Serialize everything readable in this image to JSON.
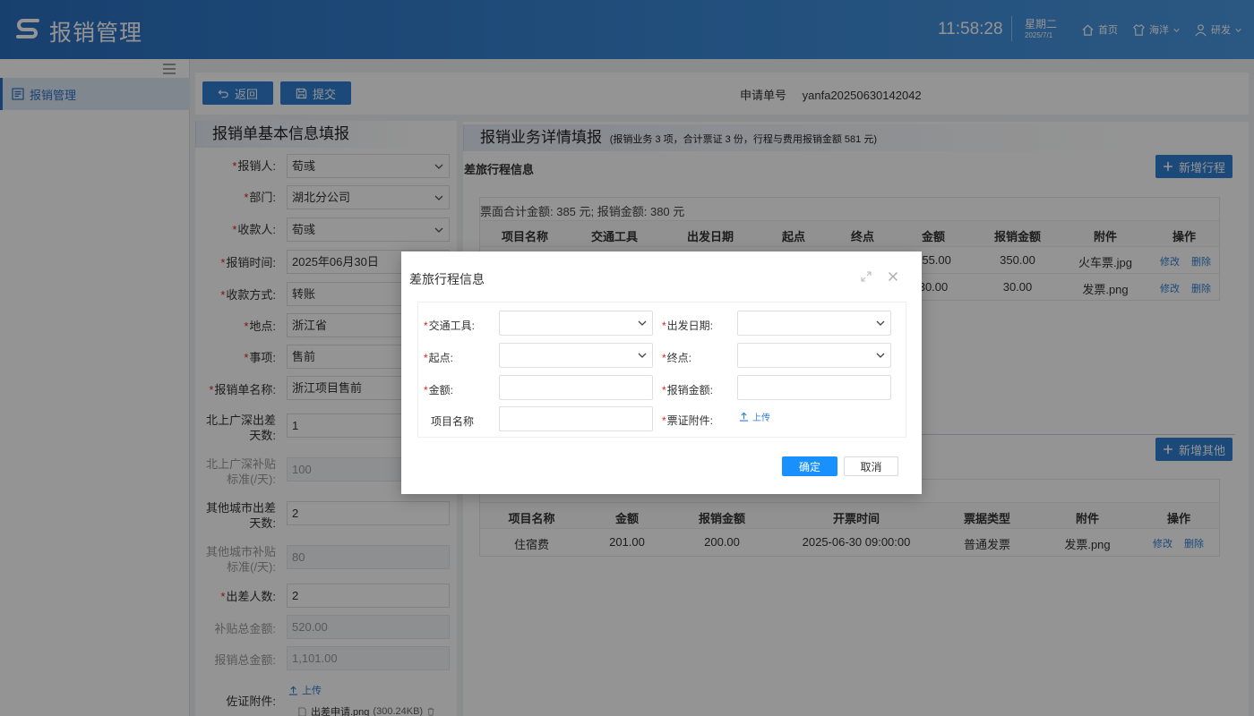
{
  "header": {
    "app_title": "报销管理",
    "clock": "11:58:28",
    "weekday": "星期二",
    "date": "2025/7/1",
    "nav_home": "首页",
    "nav_theme": "海洋",
    "nav_user": "研发"
  },
  "sidebar": {
    "items": [
      {
        "label": "报销管理"
      }
    ]
  },
  "toolbar": {
    "back_label": "返回",
    "submit_label": "提交",
    "app_no_label": "申请单号",
    "app_no_value": "yanfa20250630142042"
  },
  "basic": {
    "title": "报销单基本信息填报",
    "fields": [
      {
        "label": "报销人:",
        "value": "荀彧"
      },
      {
        "label": "部门:",
        "value": "湖北分公司"
      },
      {
        "label": "收款人:",
        "value": "荀彧"
      },
      {
        "label": "报销时间:",
        "value": "2025年06月30日"
      },
      {
        "label": "收款方式:",
        "value": "转账"
      },
      {
        "label": "地点:",
        "value": "浙江省"
      },
      {
        "label": "事项:",
        "value": "售前"
      },
      {
        "label": "报销单名称:",
        "value": "浙江项目售前"
      },
      {
        "label": "北上广深出差天数:",
        "value": "1"
      },
      {
        "label": "北上广深补贴标准(/天):",
        "value": "100"
      },
      {
        "label": "其他城市出差天数:",
        "value": "2"
      },
      {
        "label": "其他城市补贴标准(/天):",
        "value": "80"
      },
      {
        "label": "出差人数:",
        "value": "2"
      },
      {
        "label": "补贴总金额:",
        "value": "520.00"
      },
      {
        "label": "报销总金额:",
        "value": "1,101.00"
      },
      {
        "label": "佐证附件:",
        "value": ""
      }
    ],
    "upload_label": "上传",
    "attachment_name": "出差申请.png",
    "attachment_size": "(300.24KB)"
  },
  "detail": {
    "title": "报销业务详情填报",
    "summary": "(报销业务 3 项，合计票证 3 份，行程与费用报销金额  581 元)",
    "travel_section_label": "差旅行程信息",
    "add_travel_label": "新增行程",
    "travel_summary": "票面合计金额:   385 元;  报销金额:   380 元",
    "travel_headers": [
      "项目名称",
      "交通工具",
      "出发日期",
      "起点",
      "终点",
      "金额",
      "报销金额",
      "附件",
      "操作"
    ],
    "travel_rows": [
      {
        "amount": "355.00",
        "claim": "350.00",
        "file": "火车票.jpg",
        "edit": "修改",
        "del": "删除"
      },
      {
        "amount": "30.00",
        "claim": "30.00",
        "file": "发票.png",
        "edit": "修改",
        "del": "删除"
      }
    ],
    "add_other_label": "新增其他",
    "other_headers": [
      "项目名称",
      "金额",
      "报销金额",
      "开票时间",
      "票据类型",
      "附件",
      "操作"
    ],
    "other_rows": [
      {
        "name": "住宿费",
        "amount": "201.00",
        "claim": "200.00",
        "time": "2025-06-30 09:00:00",
        "type": "普通发票",
        "file": "发票.png",
        "edit": "修改",
        "del": "删除"
      }
    ]
  },
  "dialog": {
    "title": "差旅行程信息",
    "transport_label": "交通工具:",
    "depart_date_label": "出发日期:",
    "origin_label": "起点:",
    "destination_label": "终点:",
    "amount_label": "金额:",
    "claim_amount_label": "报销金额:",
    "project_name_label": "项目名称",
    "ticket_attachment_label": "票证附件:",
    "upload_label": "上传",
    "ok_label": "确定",
    "cancel_label": "取消"
  }
}
